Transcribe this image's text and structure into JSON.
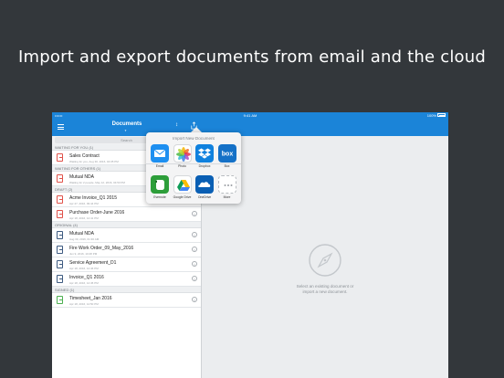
{
  "headline": "Import and export documents from email and the cloud",
  "status_bar": {
    "carrier": "•••••• ",
    "time": "9:41 AM",
    "battery": "100%"
  },
  "nav": {
    "title": "Documents",
    "caret": "▼",
    "sort_glyph": "↕"
  },
  "search": {
    "placeholder": "Search"
  },
  "sections": [
    {
      "header": "WAITING FOR YOU (1)",
      "rows": [
        {
          "title": "Sales Contract",
          "sub": "Waiting for you, Aug 30, 2016, 04:05 PM",
          "color": "#e0524a",
          "info": false
        }
      ]
    },
    {
      "header": "WAITING FOR OTHERS (1)",
      "rows": [
        {
          "title": "Mutual NDA",
          "sub": "Waiting for 2 people, May 12, 2016, 04:53 PM",
          "color": "#e0524a",
          "info": false
        }
      ]
    },
    {
      "header": "DRAFT (2)",
      "rows": [
        {
          "title": "Acme Invoice_Q1 2015",
          "sub": "Apr 27, 2016, 09:44 PM",
          "color": "#e0524a",
          "info": true
        },
        {
          "title": "Purchase Order-June 2016",
          "sub": "Apr 18, 2016, 12:41 PM",
          "color": "#e0524a",
          "info": true
        }
      ]
    },
    {
      "header": "ORIGINAL (4)",
      "rows": [
        {
          "title": "Mutual NDA",
          "sub": "Aug 30, 2016, 01:30 AM",
          "color": "#3d5a80",
          "info": true
        },
        {
          "title": "Fire Work Order_09_May_2016",
          "sub": "Jun 9, 2016, 10:28 PM",
          "color": "#3d5a80",
          "info": true
        },
        {
          "title": "Service Agreement_D1",
          "sub": "Apr 18, 2016, 12:46 PM",
          "color": "#3d5a80",
          "info": true
        },
        {
          "title": "Invoice_Q1 2016",
          "sub": "Apr 18, 2016, 12:45 PM",
          "color": "#3d5a80",
          "info": true
        }
      ]
    },
    {
      "header": "SIGNED (1)",
      "rows": [
        {
          "title": "Timesheet_Jan 2016",
          "sub": "Apr 18, 2016, 12:50 PM",
          "color": "#4caf50",
          "info": true
        }
      ]
    }
  ],
  "info_glyph": "i",
  "popover": {
    "title": "Import New Document",
    "items": [
      {
        "label": "Email",
        "icon": "mail-icon",
        "color": "#1e8ff0"
      },
      {
        "label": "Photo",
        "icon": "photos-icon",
        "color": "#ffffff"
      },
      {
        "label": "Dropbox",
        "icon": "dropbox-icon",
        "color": "#1081de"
      },
      {
        "label": "Box",
        "icon": "box-icon",
        "color": "#1571c7"
      },
      {
        "label": "Evernote",
        "icon": "evernote-icon",
        "color": "#2d9e3a"
      },
      {
        "label": "Google Drive",
        "icon": "google-drive-icon",
        "color": "#ffffff"
      },
      {
        "label": "OneDrive",
        "icon": "onedrive-icon",
        "color": "#0a5fb4"
      },
      {
        "label": "More",
        "icon": "more-icon",
        "color": "#ffffff"
      }
    ]
  },
  "empty_state": {
    "line1": "Select an existing document or",
    "line2": "import a new document."
  },
  "colors": {
    "accent": "#1b84d8",
    "background": "#33373b"
  }
}
